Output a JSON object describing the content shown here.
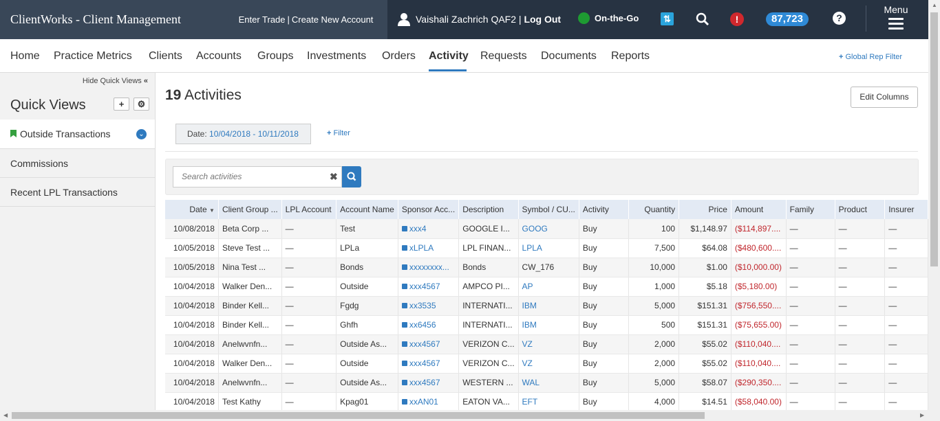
{
  "topbar": {
    "brand": "ClientWorks - Client Management",
    "enter_trade": "Enter Trade",
    "separator": "|",
    "create_account": "Create New Account",
    "user_name": "Vaishali Zachrich QAF2",
    "logout": "Log Out",
    "status": "On-the-Go",
    "notification_count": "87,723",
    "menu_label": "Menu"
  },
  "nav": {
    "items": [
      "Home",
      "Practice Metrics",
      "Clients",
      "Accounts",
      "Groups",
      "Investments",
      "Orders",
      "Activity",
      "Requests",
      "Documents",
      "Reports"
    ],
    "active": "Activity",
    "global_filter": "Global Rep Filter"
  },
  "sidebar": {
    "hide_label": "Hide Quick Views",
    "title": "Quick Views",
    "items": [
      "Outside Transactions",
      "Commissions",
      "Recent LPL Transactions"
    ]
  },
  "main": {
    "count": "19",
    "count_label": "Activities",
    "edit_columns": "Edit Columns",
    "date_label": "Date:",
    "date_value": "10/04/2018 - 10/11/2018",
    "add_filter": "Filter",
    "search_placeholder": "Search activities"
  },
  "table": {
    "headers": [
      "Date",
      "Client Group ...",
      "LPL Account",
      "Account Name",
      "Sponsor Acc...",
      "Description",
      "Symbol / CU...",
      "Activity",
      "Quantity",
      "Price",
      "Amount",
      "Family",
      "Product",
      "Insurer"
    ],
    "rows": [
      [
        "10/08/2018",
        "Beta Corp ...",
        "—",
        "Test",
        "xxx4",
        "GOOGLE I...",
        "GOOG",
        "Buy",
        "100",
        "$1,148.97",
        "($114,897....",
        "—",
        "—",
        "—"
      ],
      [
        "10/05/2018",
        "Steve Test ...",
        "—",
        "LPLa",
        "xLPLA",
        "LPL FINAN...",
        "LPLA",
        "Buy",
        "7,500",
        "$64.08",
        "($480,600....",
        "—",
        "—",
        "—"
      ],
      [
        "10/05/2018",
        "Nina Test ...",
        "—",
        "Bonds",
        "xxxxxxxx...",
        "Bonds",
        "CW_176",
        "Buy",
        "10,000",
        "$1.00",
        "($10,000.00)",
        "—",
        "—",
        "—"
      ],
      [
        "10/04/2018",
        "Walker Den...",
        "—",
        "Outside",
        "xxx4567",
        "AMPCO PI...",
        "AP",
        "Buy",
        "1,000",
        "$5.18",
        "($5,180.00)",
        "—",
        "—",
        "—"
      ],
      [
        "10/04/2018",
        "Binder Kell...",
        "—",
        "Fgdg",
        "xx3535",
        "INTERNATI...",
        "IBM",
        "Buy",
        "5,000",
        "$151.31",
        "($756,550....",
        "—",
        "—",
        "—"
      ],
      [
        "10/04/2018",
        "Binder Kell...",
        "—",
        "Ghfh",
        "xx6456",
        "INTERNATI...",
        "IBM",
        "Buy",
        "500",
        "$151.31",
        "($75,655.00)",
        "—",
        "—",
        "—"
      ],
      [
        "10/04/2018",
        "Anelwvnfn...",
        "—",
        "Outside As...",
        "xxx4567",
        "VERIZON C...",
        "VZ",
        "Buy",
        "2,000",
        "$55.02",
        "($110,040....",
        "—",
        "—",
        "—"
      ],
      [
        "10/04/2018",
        "Walker Den...",
        "—",
        "Outside",
        "xxx4567",
        "VERIZON C...",
        "VZ",
        "Buy",
        "2,000",
        "$55.02",
        "($110,040....",
        "—",
        "—",
        "—"
      ],
      [
        "10/04/2018",
        "Anelwvnfn...",
        "—",
        "Outside As...",
        "xxx4567",
        "WESTERN ...",
        "WAL",
        "Buy",
        "5,000",
        "$58.07",
        "($290,350....",
        "—",
        "—",
        "—"
      ],
      [
        "10/04/2018",
        "Test Kathy",
        "—",
        "Kpag01",
        "xxAN01",
        "EATON VA...",
        "EFT",
        "Buy",
        "4,000",
        "$14.51",
        "($58,040.00)",
        "—",
        "—",
        "—"
      ]
    ],
    "symbol_links": [
      "GOOG",
      "LPLA",
      "AP",
      "IBM",
      "VZ",
      "WAL",
      "EFT"
    ]
  },
  "colors": {
    "topbar": "#273342",
    "accent": "#2f7abf",
    "negative": "#c0262c",
    "status_green": "#1e9b32",
    "alert_red": "#d0282d"
  }
}
